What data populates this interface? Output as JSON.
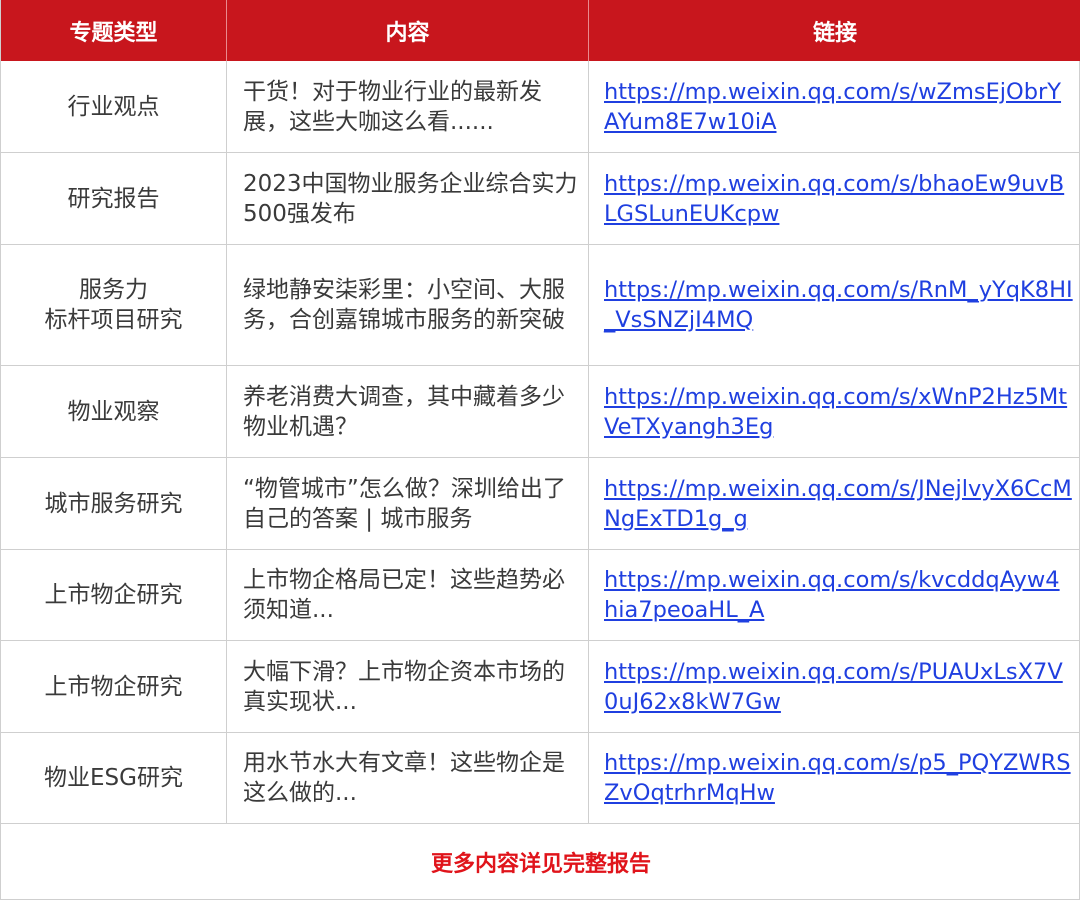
{
  "header": {
    "col1": "专题类型",
    "col2": "内容",
    "col3": "链接"
  },
  "rows": [
    {
      "type": "行业观点",
      "content": "干货！对于物业行业的最新发展，这些大咖这么看......",
      "link": "https://mp.weixin.qq.com/s/wZmsEjObrYAYum8E7w10iA"
    },
    {
      "type": "研究报告",
      "content": "2023中国物业服务企业综合实力500强发布",
      "link": "https://mp.weixin.qq.com/s/bhaoEw9uvBLGSLunEUKcpw"
    },
    {
      "type": "服务力\n标杆项目研究",
      "content": "绿地静安柒彩里：小空间、大服务，合创嘉锦城市服务的新突破",
      "link": "https://mp.weixin.qq.com/s/RnM_yYqK8HI_VsSNZjI4MQ"
    },
    {
      "type": "物业观察",
      "content": "养老消费大调查，其中藏着多少物业机遇？",
      "link": "https://mp.weixin.qq.com/s/xWnP2Hz5MtVeTXyangh3Eg"
    },
    {
      "type": "城市服务研究",
      "content": "“物管城市”怎么做？深圳给出了自己的答案 | 城市服务",
      "link": "https://mp.weixin.qq.com/s/JNejlvyX6CcMNgExTD1g_g"
    },
    {
      "type": "上市物企研究",
      "content": "上市物企格局已定！这些趋势必须知道...",
      "link": "https://mp.weixin.qq.com/s/kvcddqAyw4hia7peoaHL_A"
    },
    {
      "type": "上市物企研究",
      "content": "大幅下滑？上市物企资本市场的真实现状...",
      "link": "https://mp.weixin.qq.com/s/PUAUxLsX7V0uJ62x8kW7Gw"
    },
    {
      "type": "物业ESG研究",
      "content": "用水节水大有文章！这些物企是这么做的...",
      "link": "https://mp.weixin.qq.com/s/p5_PQYZWRSZvOqtrhrMqHw"
    }
  ],
  "footer": {
    "text": "更多内容详见完整报告"
  },
  "colors": {
    "header_bg": "#c8161d",
    "link": "#1f3fe0",
    "footer_text": "#e0141b"
  }
}
